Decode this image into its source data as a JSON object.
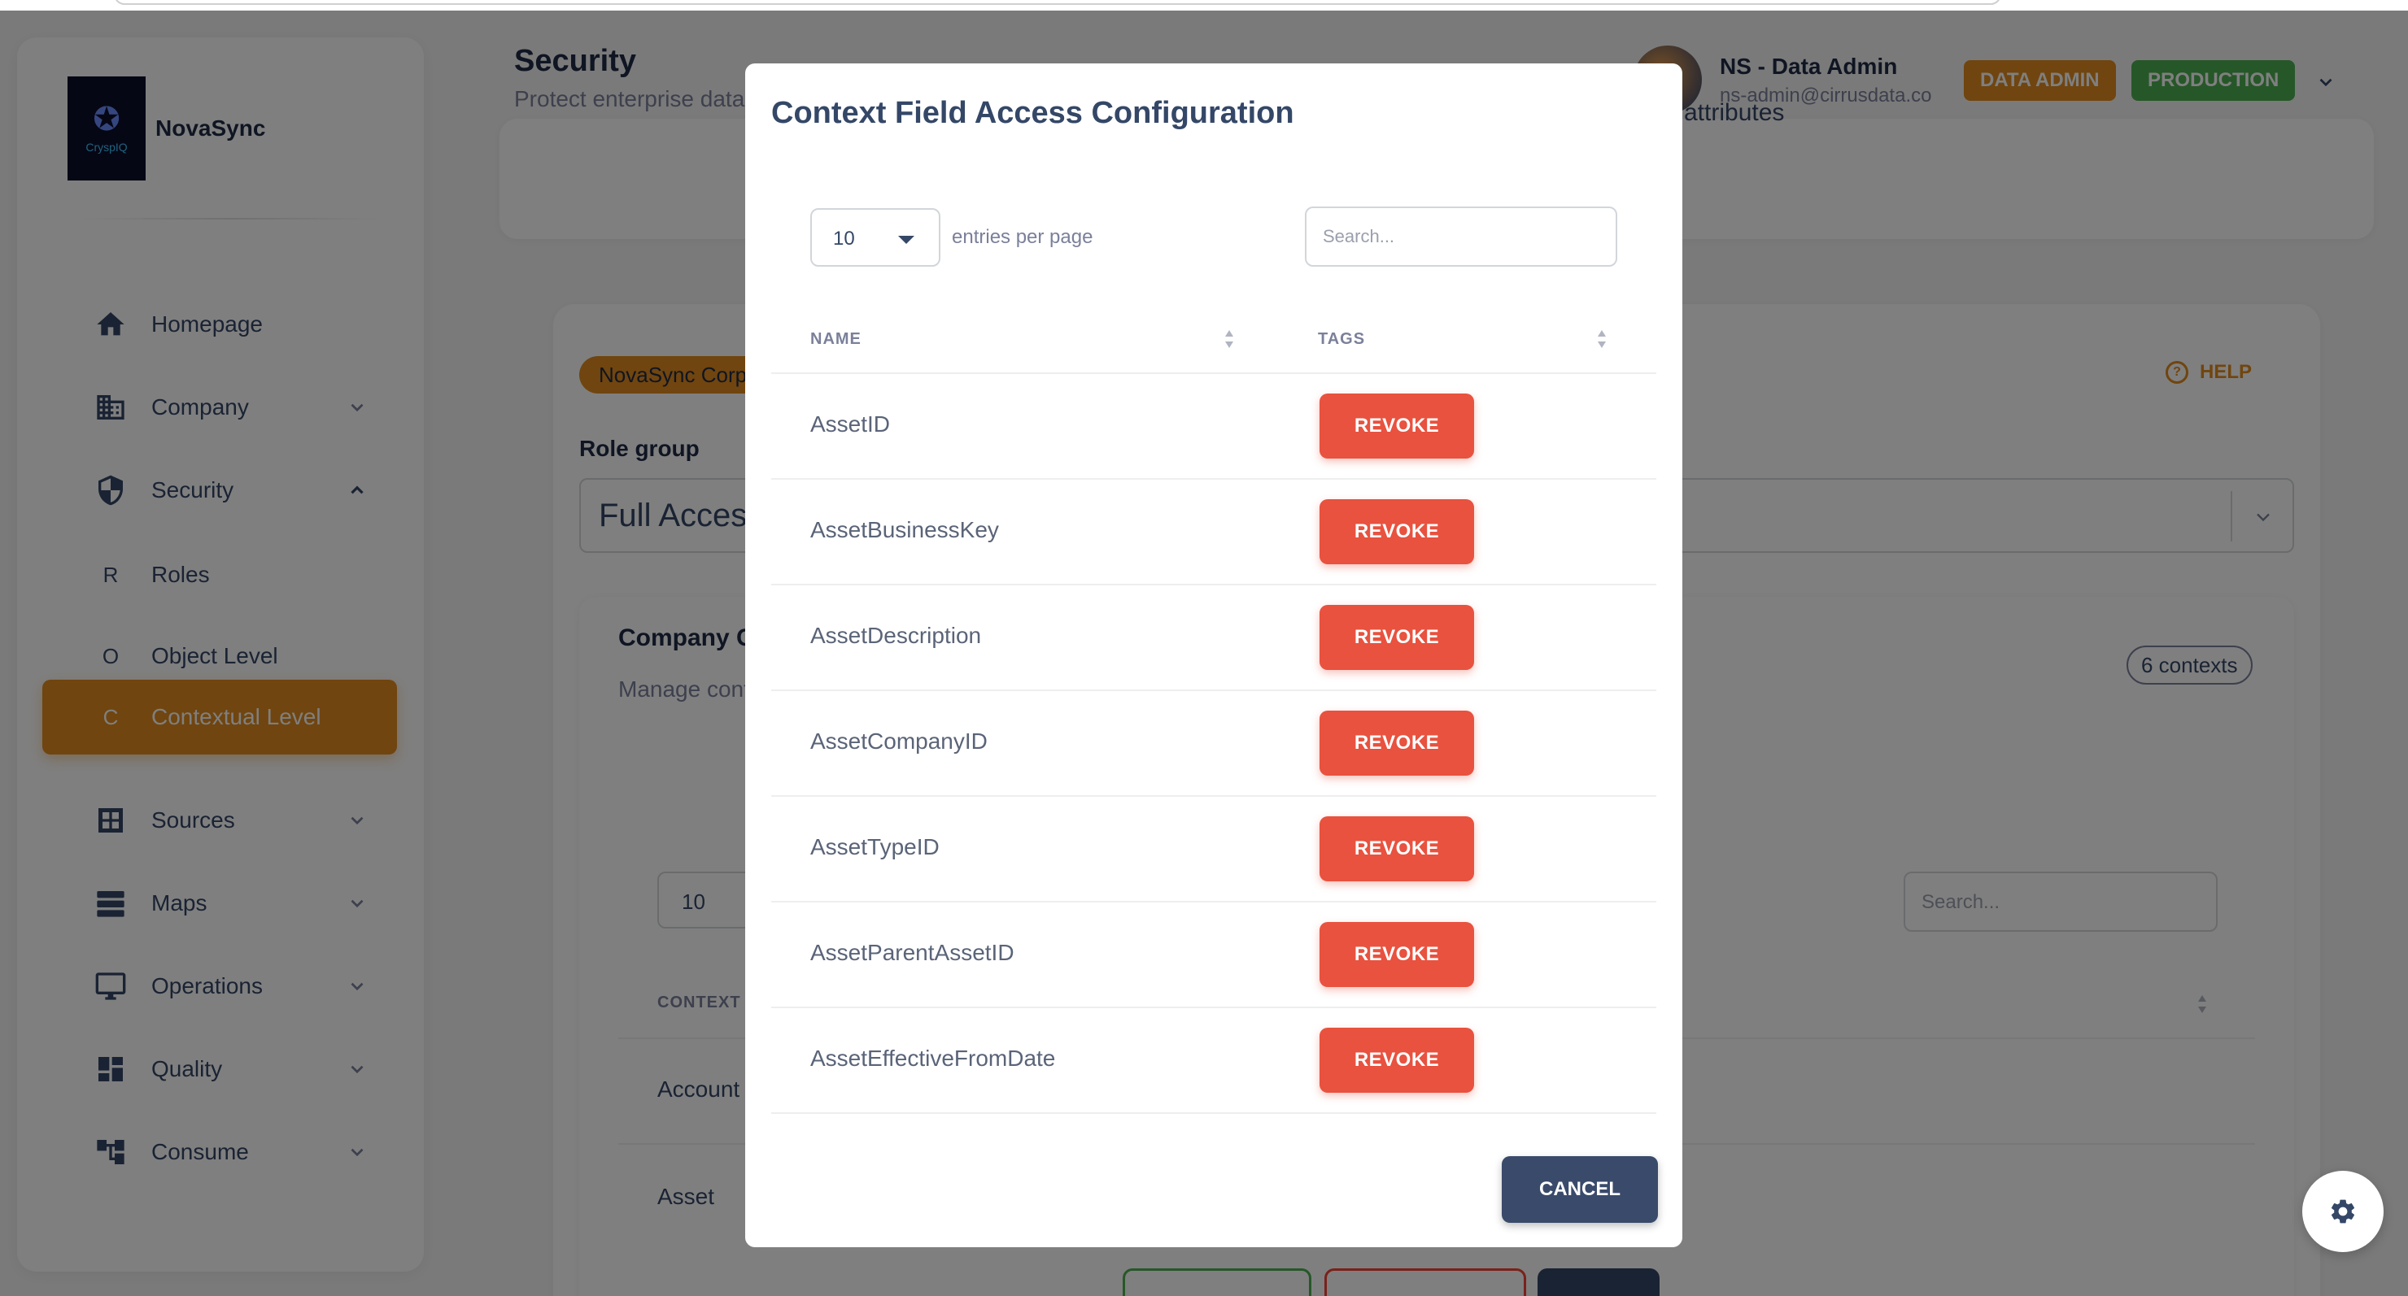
{
  "app": {
    "brand_name": "NovaSync",
    "logo_text": "CryspIQ"
  },
  "sidebar": {
    "items": [
      {
        "label": "Homepage",
        "icon": "home-icon"
      },
      {
        "label": "Company",
        "icon": "building-icon"
      },
      {
        "label": "Security",
        "icon": "shield-icon"
      },
      {
        "label": "Roles",
        "letter": "R"
      },
      {
        "label": "Object Level",
        "letter": "O"
      },
      {
        "label": "Contextual Level",
        "letter": "C"
      },
      {
        "label": "Sources",
        "icon": "grid-icon"
      },
      {
        "label": "Maps",
        "icon": "layers-icon"
      },
      {
        "label": "Operations",
        "icon": "monitor-icon"
      },
      {
        "label": "Quality",
        "icon": "dashboard-icon"
      },
      {
        "label": "Consume",
        "icon": "hierarchy-icon"
      }
    ]
  },
  "header": {
    "title": "Security",
    "subtitle": "Protect enterprise data",
    "attributes_text": "attributes",
    "user_name": "NS - Data Admin",
    "user_email": "ns-admin@cirrusdata.co",
    "badge_role": "DATA ADMIN",
    "badge_env": "PRODUCTION"
  },
  "main": {
    "company_pill": "NovaSync Corporation",
    "help_label": "HELP",
    "role_group_label": "Role group",
    "role_group_value": "Full Access",
    "company_title": "Company Contexts",
    "company_subtitle": "Manage contexts",
    "contexts_count": "6 contexts",
    "entries_value": "10",
    "search_placeholder": "Search...",
    "column_context": "CONTEXT",
    "rows": [
      "Account",
      "Asset"
    ]
  },
  "modal": {
    "title": "Context Field Access Configuration",
    "entries_value": "10",
    "entries_label": "entries per page",
    "search_placeholder": "Search...",
    "columns": {
      "name": "NAME",
      "tags": "TAGS"
    },
    "rows": [
      {
        "name": "AssetID",
        "action": "REVOKE"
      },
      {
        "name": "AssetBusinessKey",
        "action": "REVOKE"
      },
      {
        "name": "AssetDescription",
        "action": "REVOKE"
      },
      {
        "name": "AssetCompanyID",
        "action": "REVOKE"
      },
      {
        "name": "AssetTypeID",
        "action": "REVOKE"
      },
      {
        "name": "AssetParentAssetID",
        "action": "REVOKE"
      },
      {
        "name": "AssetEffectiveFromDate",
        "action": "REVOKE"
      }
    ],
    "cancel_label": "CANCEL"
  },
  "colors": {
    "accent": "#e08a1e",
    "revoke": "#e8523f",
    "production": "#4caf50",
    "cancel": "#3a4a6b"
  }
}
